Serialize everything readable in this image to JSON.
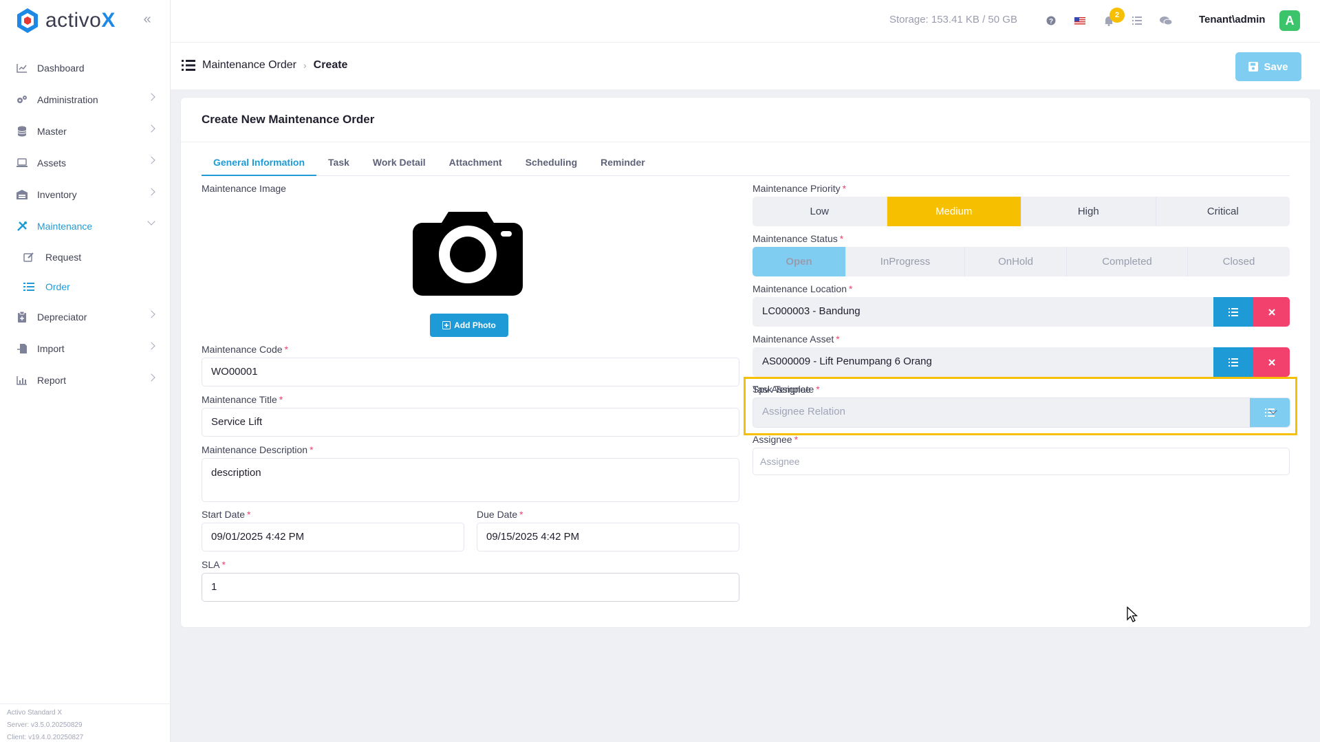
{
  "app": {
    "logo_prefix": "activo",
    "logo_suffix": "X"
  },
  "sidebar": {
    "items": [
      {
        "label": "Dashboard"
      },
      {
        "label": "Administration"
      },
      {
        "label": "Master"
      },
      {
        "label": "Assets"
      },
      {
        "label": "Inventory"
      },
      {
        "label": "Maintenance"
      },
      {
        "label": "Request"
      },
      {
        "label": "Order"
      },
      {
        "label": "Depreciator"
      },
      {
        "label": "Import"
      },
      {
        "label": "Report"
      }
    ],
    "footer": {
      "product": "Activo Standard X",
      "server": "Server: v3.5.0.20250829",
      "client": "Client: v19.4.0.20250827"
    }
  },
  "topbar": {
    "storage": "Storage: 153.41 KB / 50 GB",
    "notification_count": "2",
    "tenant": "Tenant\\admin",
    "avatar_letter": "A"
  },
  "breadcrumb": {
    "parent": "Maintenance Order",
    "current": "Create"
  },
  "actions": {
    "save_label": "Save"
  },
  "form": {
    "title": "Create New Maintenance Order",
    "tabs": [
      "General Information",
      "Task",
      "Work Detail",
      "Attachment",
      "Scheduling",
      "Reminder"
    ],
    "image_label": "Maintenance Image",
    "add_photo_label": "Add Photo",
    "code": {
      "label": "Maintenance Code",
      "value": "WO00001"
    },
    "title_field": {
      "label": "Maintenance Title",
      "value": "Service Lift"
    },
    "description": {
      "label": "Maintenance Description",
      "value": "description"
    },
    "start_date": {
      "label": "Start Date",
      "value": "09/01/2025 4:42 PM"
    },
    "due_date": {
      "label": "Due Date",
      "value": "09/15/2025 4:42 PM"
    },
    "sla": {
      "label": "SLA",
      "value": "1"
    },
    "priority": {
      "label": "Maintenance Priority",
      "options": [
        "Low",
        "Medium",
        "High",
        "Critical"
      ],
      "selected": "Medium"
    },
    "status": {
      "label": "Maintenance Status",
      "options": [
        "Open",
        "InProgress",
        "OnHold",
        "Completed",
        "Closed"
      ],
      "selected": "Open"
    },
    "location": {
      "label": "Maintenance Location",
      "value": "LC000003 - Bandung"
    },
    "asset": {
      "label": "Maintenance Asset",
      "value": "AS000009 - Lift Penumpang 6 Orang"
    },
    "task_template": {
      "label": "Task Template",
      "value": ""
    },
    "spv_assignee": {
      "label": "Spv Assignee",
      "placeholder": "Assignee Relation"
    },
    "assignee": {
      "label": "Assignee",
      "placeholder": "Assignee"
    }
  },
  "colors": {
    "accent": "#1e9bd7",
    "highlight": "#f6c000",
    "danger": "#f1416c",
    "success": "#3cc46a"
  }
}
